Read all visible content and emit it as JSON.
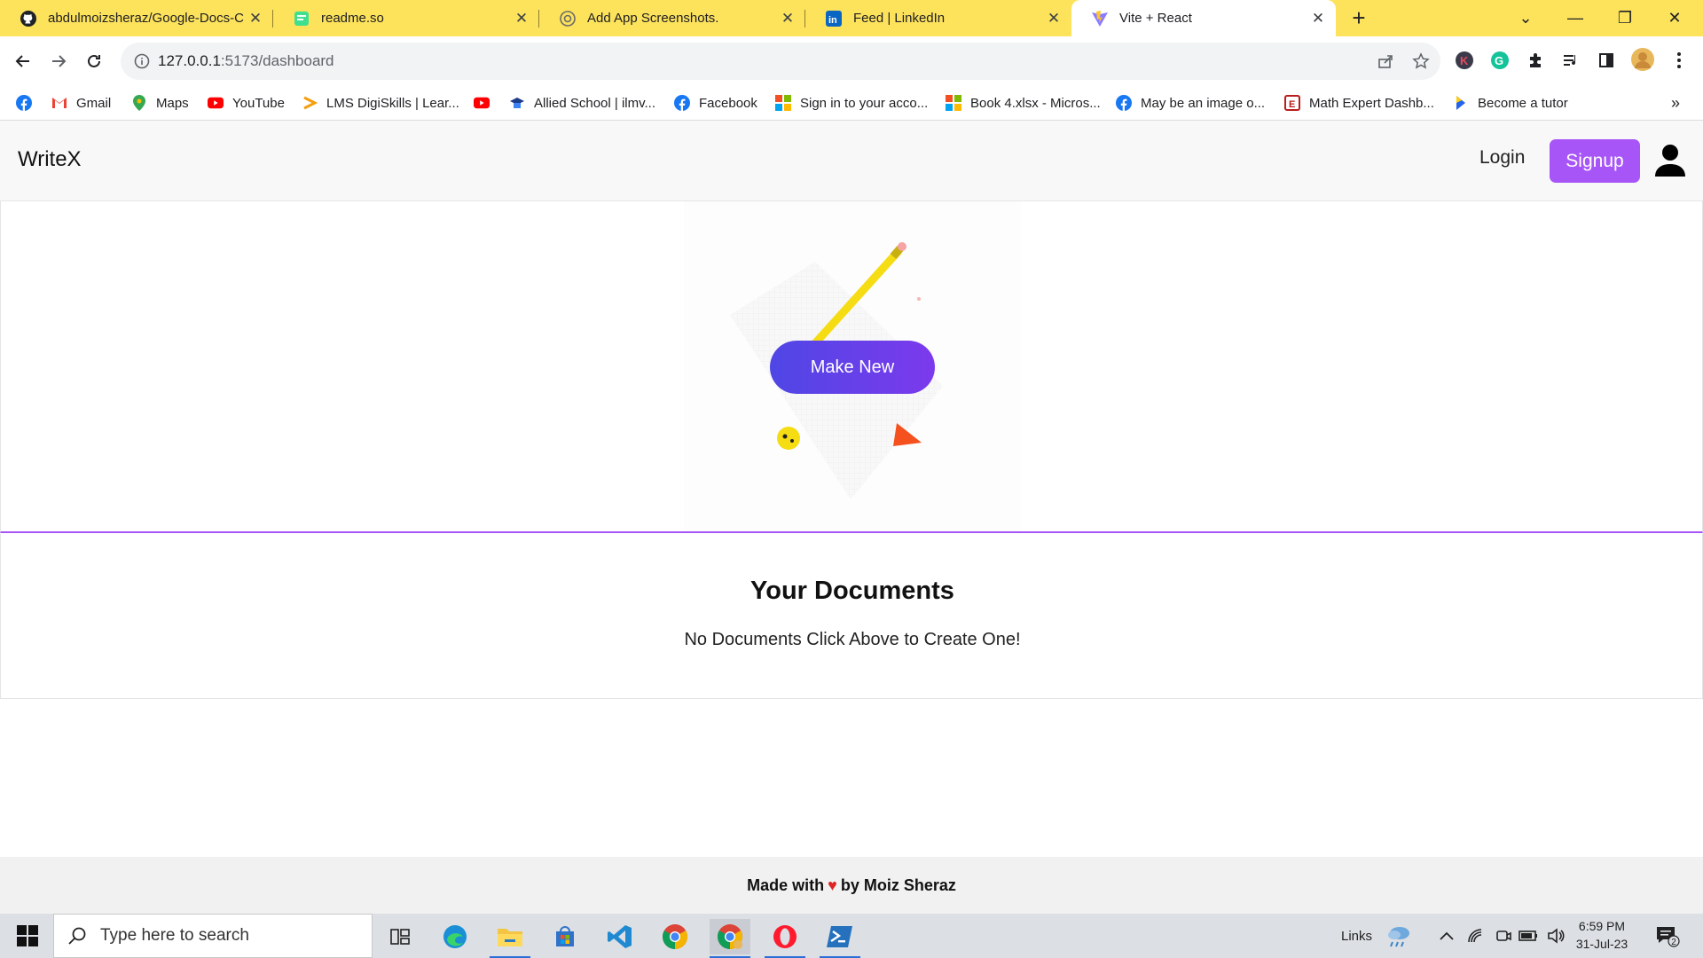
{
  "browser": {
    "tabs": [
      {
        "title": "abdulmoizsheraz/Google-Docs-C",
        "icon": "github-icon"
      },
      {
        "title": "readme.so",
        "icon": "readme-icon"
      },
      {
        "title": "Add App Screenshots.",
        "icon": "openai-icon"
      },
      {
        "title": "Feed | LinkedIn",
        "icon": "linkedin-icon"
      },
      {
        "title": "Vite + React",
        "icon": "vite-icon"
      }
    ],
    "url_host": "127.0.0.1",
    "url_path": ":5173/dashboard",
    "profile_letter": "K",
    "bookmarks": [
      {
        "label": "",
        "icon": "facebook-icon"
      },
      {
        "label": "Gmail",
        "icon": "gmail-icon"
      },
      {
        "label": "Maps",
        "icon": "maps-icon"
      },
      {
        "label": "YouTube",
        "icon": "youtube-icon"
      },
      {
        "label": "LMS DigiSkills | Lear...",
        "icon": "digiskills-icon"
      },
      {
        "label": "",
        "icon": "youtube-icon"
      },
      {
        "label": "Allied School | ilmv...",
        "icon": "school-icon"
      },
      {
        "label": "Facebook",
        "icon": "facebook-icon"
      },
      {
        "label": "Sign in to your acco...",
        "icon": "microsoft-icon"
      },
      {
        "label": "Book 4.xlsx - Micros...",
        "icon": "microsoft-icon"
      },
      {
        "label": "May be an image o...",
        "icon": "facebook-icon"
      },
      {
        "label": "Math Expert Dashb...",
        "icon": "math-icon"
      },
      {
        "label": "Become a tutor",
        "icon": "tutor-icon"
      }
    ],
    "more_bookmarks": "»"
  },
  "app": {
    "brand": "WriteX",
    "login_label": "Login",
    "signup_label": "Signup",
    "make_new_label": "Make New",
    "docs_title": "Your Documents",
    "docs_empty": "No Documents Click Above to Create One!",
    "footer_prefix": "Made with",
    "footer_heart": "♥",
    "footer_suffix": "by Moiz Sheraz",
    "accent_color": "#a855f7",
    "button_gradient": [
      "#4f46e5",
      "#7c3aed"
    ]
  },
  "taskbar": {
    "search_placeholder": "Type here to search",
    "links_label": "Links",
    "time": "6:59 PM",
    "date": "31-Jul-23",
    "notification_count": "2"
  }
}
